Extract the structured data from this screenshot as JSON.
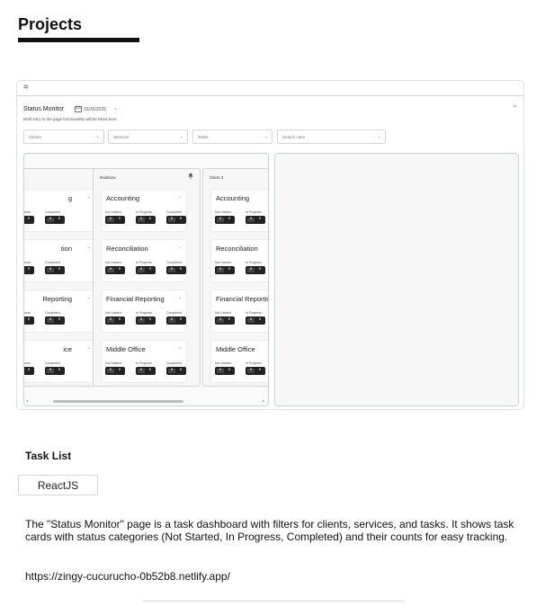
{
  "page": {
    "title": "Projects",
    "section_title": "Task List",
    "tech_tag": "ReactJS",
    "description": "The \"Status Monitor\" page is a task dashboard with filters for clients, services, and tasks. It shows task cards with status categories (Not Started, In Progress, Completed) and their counts for easy tracking.",
    "url": "https://zingy-cucurucho-0b52b8.netlify.app/"
  },
  "screenshot": {
    "menu_icon": "=",
    "header": {
      "title": "Status Monitor",
      "date": "03/25/2025",
      "description": "Brief intro to the page functionality will be listed here."
    },
    "filters": [
      {
        "label": "Clients"
      },
      {
        "label": "Services"
      },
      {
        "label": "Tasks"
      },
      {
        "label": "Search Here"
      }
    ],
    "status_labels": {
      "not_started": "Not Started",
      "in_progress": "In Progress",
      "completed": "Completed"
    },
    "count_zero": "0",
    "columns": [
      {
        "name": "",
        "cards": [
          "g",
          "tion",
          "Reporting",
          "ice"
        ]
      },
      {
        "name": "Rainbow",
        "cards": [
          "Accounting",
          "Reconciliation",
          "Financial Reporting",
          "Middle Office"
        ]
      },
      {
        "name": "Client 3",
        "cards": [
          "Accounting",
          "Reconciliation",
          "Financial Reporting",
          "Middle Office"
        ]
      }
    ]
  },
  "colors": {
    "accent_border": "#b9dfcc",
    "pill": "#222222"
  }
}
